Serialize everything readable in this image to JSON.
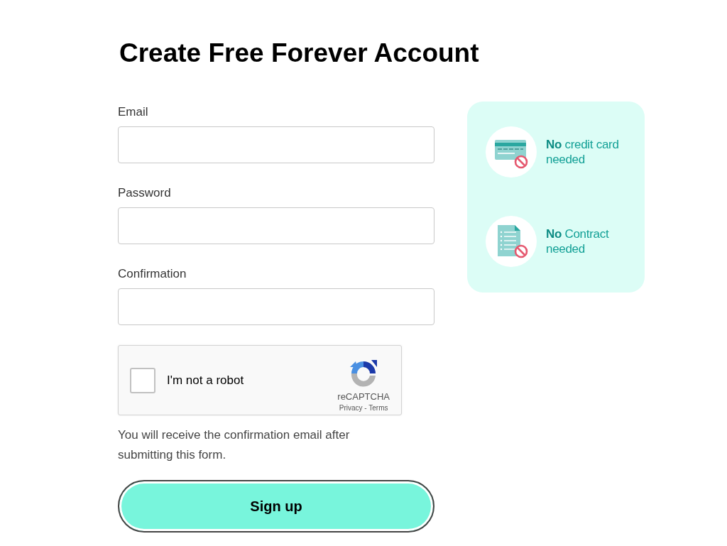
{
  "title": "Create Free Forever Account",
  "fields": [
    {
      "label": "Email"
    },
    {
      "label": "Password"
    },
    {
      "label": "Confirmation"
    }
  ],
  "captcha": {
    "label": "I'm not a robot",
    "checked": false,
    "brand": "reCAPTCHA",
    "links": "Privacy - Terms"
  },
  "note": "You will receive the confirmation email after submitting this form.",
  "submit": "Sign up",
  "benefits": [
    {
      "kind": "card",
      "text": "**No** credit card needed"
    },
    {
      "kind": "document",
      "text": "**No** Contract needed"
    }
  ]
}
